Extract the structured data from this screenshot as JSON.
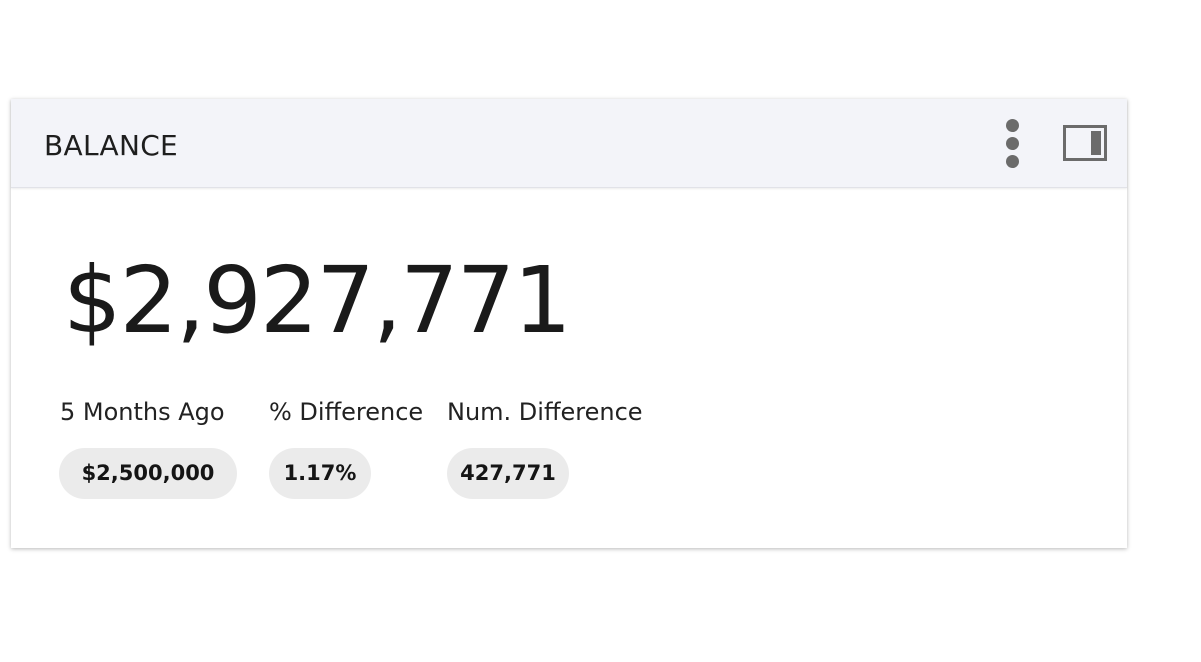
{
  "widget": {
    "title": "BALANCE",
    "menu_icon": "more-vertical-icon",
    "panel_icon": "side-panel-icon",
    "main_value": "$2,927,771",
    "stats": [
      {
        "label": "5 Months Ago",
        "value": "$2,500,000"
      },
      {
        "label": "% Difference",
        "value": "1.17%"
      },
      {
        "label": "Num. Difference",
        "value": "427,771"
      }
    ]
  },
  "colors": {
    "header_bg": "#f3f4f9",
    "icon": "#6b6b6b",
    "pill_bg": "#ebebeb",
    "text": "#1a1a1a"
  }
}
